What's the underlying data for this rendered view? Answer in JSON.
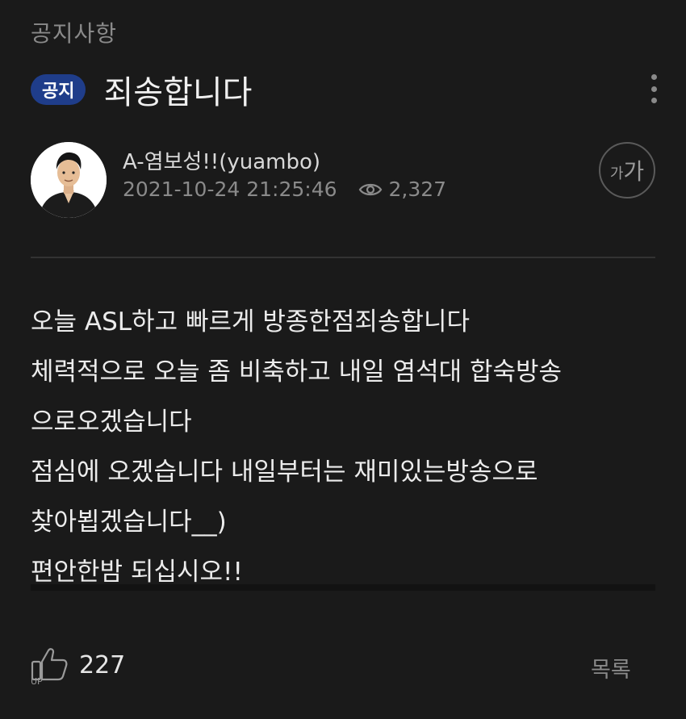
{
  "breadcrumb": "공지사항",
  "post": {
    "badge": "공지",
    "title": "죄송합니다",
    "author": "A-염보성!!(yuambo)",
    "datetime": "2021-10-24 21:25:46",
    "views": "2,327",
    "font_small": "가",
    "font_large": "가",
    "content": [
      "오늘 ASL하고 빠르게 방종한점죄송합니다",
      "체력적으로 오늘 좀 비축하고 내일 염석대 합숙방송",
      "으로오겠습니다",
      "점심에 오겠습니다 내일부터는 재미있는방송으로",
      "찾아뵙겠습니다__)",
      "편안한밤 되십시오!!"
    ],
    "likes": "227",
    "list_label": "목록"
  },
  "icons": {
    "views": "eye-icon",
    "like": "thumbs-up-icon",
    "more": "more-vertical-icon"
  },
  "colors": {
    "background": "#1a1a1a",
    "badge": "#1f3d8a",
    "muted": "#8a8a8a"
  }
}
